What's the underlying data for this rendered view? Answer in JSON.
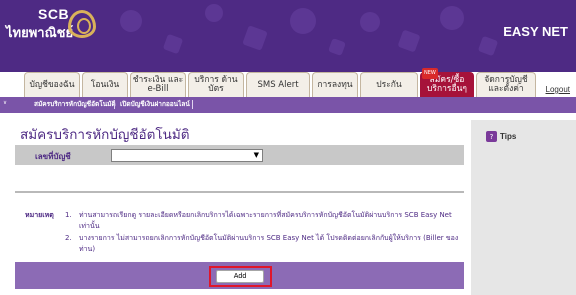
{
  "brand": {
    "logo_en": "SCB",
    "logo_th": "ไทยพาณิชย์",
    "product": "EASY NET"
  },
  "tabs": [
    {
      "label": "บัญชีของฉัน",
      "icon": ""
    },
    {
      "label": "โอนเงิน",
      "icon": ""
    },
    {
      "label": "ชำระเงิน และ e-Bill",
      "icon": ""
    },
    {
      "label": "บริการ ด้านบัตร",
      "icon": ""
    },
    {
      "label": "SMS Alert",
      "icon": ""
    },
    {
      "label": "การลงทุน",
      "icon": ""
    },
    {
      "label": "ประกัน",
      "icon": ""
    },
    {
      "label": "สมัคร/ซื้อ บริการอื่นๆ",
      "badge": "NEW"
    },
    {
      "label": "จัดการบัญชี และตั้งค่า",
      "icon": ""
    }
  ],
  "logout": "Logout",
  "subbar": {
    "left_label": "∨",
    "items": [
      "สมัครบริการหักบัญชีอัตโนมัติ",
      "เปิดบัญชีเงินฝากออนไลน์"
    ]
  },
  "page": {
    "title": "สมัครบริการหักบัญชีอัตโนมัติ",
    "account_label": "เลขที่บัญชี",
    "account_value": "",
    "note_label": "หมายเหตุ",
    "notes": [
      {
        "num": "1.",
        "text": "ท่านสามารถเรียกดู รายละเอียดหรือยกเลิกบริการได้เฉพาะรายการที่สมัครบริการหักบัญชีอัตโนมัติผ่านบริการ SCB Easy Net เท่านั้น"
      },
      {
        "num": "2.",
        "text": "บางรายการ ไม่สามารถยกเลิกการหักบัญชีอัตโนมัติผ่านบริการ SCB Easy Net ได้ โปรดติดต่อยกเลิกกับผู้ให้บริการ (Biller ของท่าน)"
      }
    ],
    "add_button": "Add"
  },
  "tips": {
    "icon_label": "?",
    "title": "Tips"
  },
  "colors": {
    "brand_purple": "#4e2a84",
    "light_purple": "#8c6bb5",
    "highlight_red": "#e0162b"
  }
}
